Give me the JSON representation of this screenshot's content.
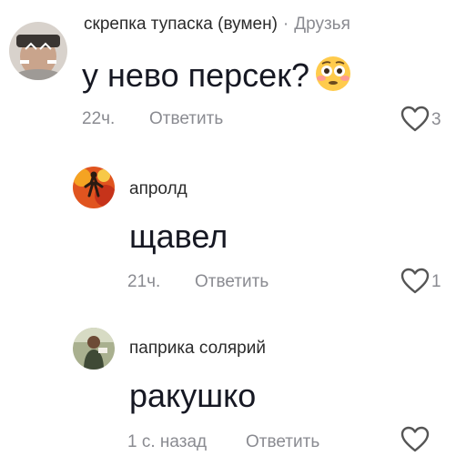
{
  "comments": [
    {
      "username": "скрепка тупаска (вумен)",
      "separator": "·",
      "tag": "Друзья",
      "text": "у нево персек?",
      "emoji": "flushed-face",
      "time": "22ч.",
      "reply_label": "Ответить",
      "likes": "3"
    },
    {
      "username": "апролд",
      "text": "щавел",
      "time": "21ч.",
      "reply_label": "Ответить",
      "likes": "1"
    },
    {
      "username": "паприка солярий",
      "text": "ракушко",
      "time": "1 с. назад",
      "reply_label": "Ответить",
      "likes": ""
    }
  ],
  "colors": {
    "text": "#161823",
    "muted": "#8a8b91",
    "username": "#2b2b2b"
  },
  "icons": [
    "heart-outline-icon",
    "flushed-face-emoji"
  ]
}
